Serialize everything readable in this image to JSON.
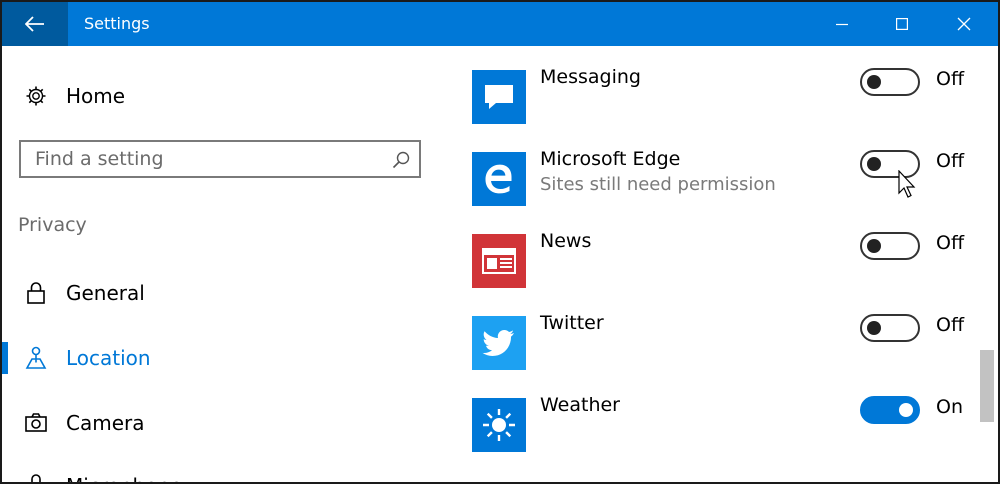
{
  "window": {
    "title": "Settings",
    "accent": "#0078d7"
  },
  "sidebar": {
    "home_label": "Home",
    "search_placeholder": "Find a setting",
    "section_label": "Privacy",
    "items": [
      {
        "label": "General",
        "icon": "lock-icon"
      },
      {
        "label": "Location",
        "icon": "location-icon",
        "active": true
      },
      {
        "label": "Camera",
        "icon": "camera-icon"
      },
      {
        "label": "Microphone",
        "icon": "microphone-icon"
      }
    ]
  },
  "apps": [
    {
      "name": "Messaging",
      "subtitle": "",
      "state": "Off",
      "on": false,
      "tile_color": "#0078d7",
      "icon": "messaging-icon"
    },
    {
      "name": "Microsoft Edge",
      "subtitle": "Sites still need permission",
      "state": "Off",
      "on": false,
      "tile_color": "#0078d7",
      "icon": "edge-icon"
    },
    {
      "name": "News",
      "subtitle": "",
      "state": "Off",
      "on": false,
      "tile_color": "#d13438",
      "icon": "news-icon"
    },
    {
      "name": "Twitter",
      "subtitle": "",
      "state": "Off",
      "on": false,
      "tile_color": "#1da1f2",
      "icon": "twitter-icon"
    },
    {
      "name": "Weather",
      "subtitle": "",
      "state": "On",
      "on": true,
      "tile_color": "#0078d7",
      "icon": "weather-icon"
    }
  ]
}
